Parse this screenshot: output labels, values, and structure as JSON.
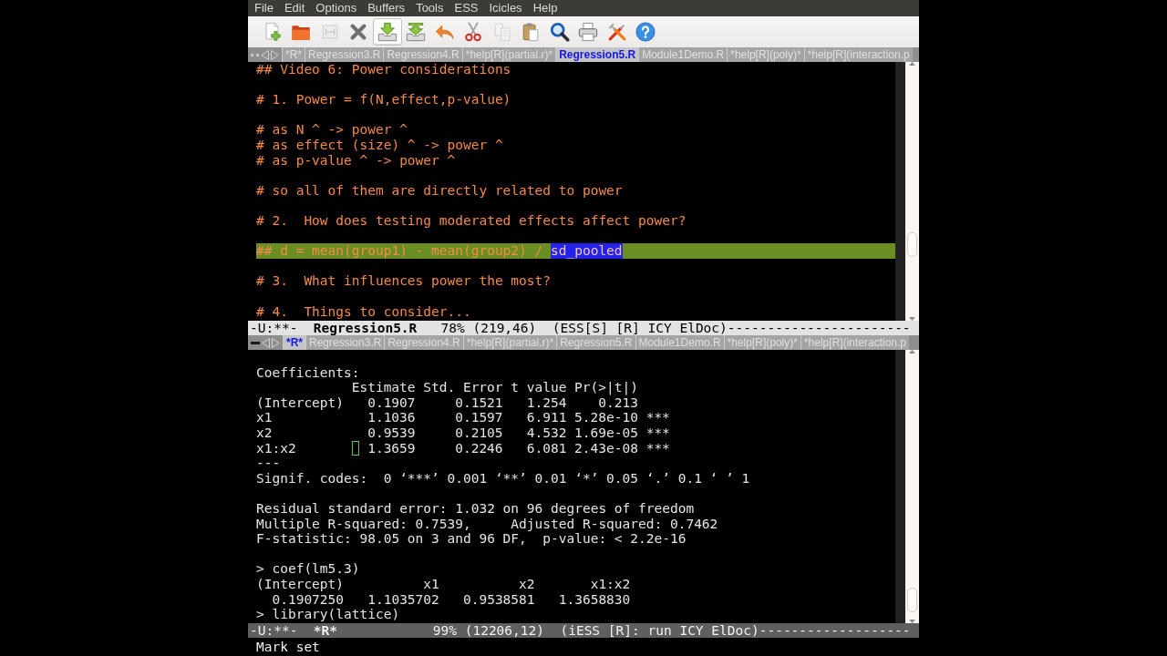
{
  "menu_bar": [
    "File",
    "Edit",
    "Options",
    "Buffers",
    "Tools",
    "ESS",
    "Icicles",
    "Help"
  ],
  "toolbar": [
    {
      "kind": "new",
      "disabled": false,
      "hovered": false
    },
    {
      "kind": "open",
      "disabled": false,
      "hovered": false
    },
    {
      "kind": "frame",
      "disabled": true,
      "hovered": false
    },
    {
      "kind": "close",
      "disabled": false,
      "hovered": false
    },
    {
      "kind": "save",
      "disabled": false,
      "hovered": true
    },
    {
      "kind": "saveas",
      "disabled": false,
      "hovered": false
    },
    {
      "kind": "undo",
      "disabled": false,
      "hovered": false
    },
    {
      "kind": "cut",
      "disabled": false,
      "hovered": false
    },
    {
      "kind": "copy",
      "disabled": true,
      "hovered": false
    },
    {
      "kind": "paste",
      "disabled": false,
      "hovered": false
    },
    {
      "kind": "search",
      "disabled": false,
      "hovered": false
    },
    {
      "kind": "print",
      "disabled": false,
      "hovered": false
    },
    {
      "kind": "preferences",
      "disabled": false,
      "hovered": false
    },
    {
      "kind": "help",
      "disabled": false,
      "hovered": false
    }
  ],
  "windows": [
    {
      "kind": "editor",
      "active": true,
      "tabs": [
        {
          "label": "*R*",
          "selected": false
        },
        {
          "label": "Regression3.R",
          "selected": false
        },
        {
          "label": "Regression4.R",
          "selected": false
        },
        {
          "label": "*help[R](partial.r)*",
          "selected": false
        },
        {
          "label": "Regression5.R",
          "selected": true
        },
        {
          "label": "Module1Demo.R",
          "selected": false
        },
        {
          "label": "*help[R](poly)*",
          "selected": false
        },
        {
          "label": "*help[R](interaction.p",
          "selected": false
        }
      ],
      "lines": [
        {
          "kind": "text",
          "text": "## Video 6: Power considerations"
        },
        {
          "kind": "blank"
        },
        {
          "kind": "text",
          "text": "# 1. Power = f(N,effect,p-value)"
        },
        {
          "kind": "blank"
        },
        {
          "kind": "text",
          "text": "# as N ^ -> power ^"
        },
        {
          "kind": "text",
          "text": "# as effect (size) ^ -> power ^"
        },
        {
          "kind": "text",
          "text": "# as p-value ^ -> power ^"
        },
        {
          "kind": "blank"
        },
        {
          "kind": "text",
          "text": "# so all of them are directly related to power"
        },
        {
          "kind": "blank"
        },
        {
          "kind": "text",
          "text": "# 2.  How does testing moderated effects affect power?"
        },
        {
          "kind": "blank"
        },
        {
          "kind": "current",
          "text": "## d = mean(group1) - mean(group2) /",
          "selection": "sd_pooled"
        },
        {
          "kind": "blank"
        },
        {
          "kind": "text",
          "text": "# 3.  What influences power the most?"
        },
        {
          "kind": "blank"
        },
        {
          "kind": "text",
          "text": "# 4.  Things to consider..."
        }
      ],
      "mode_line": {
        "status": "-U:**-",
        "buffer": "Regression5.R",
        "position": "78% (219,46)",
        "modes": "(ESS[S] [R] ICY ElDoc)",
        "dashes": "-----------------------"
      }
    },
    {
      "kind": "console",
      "active": false,
      "tabs": [
        {
          "label": "*R*",
          "selected": true
        },
        {
          "label": "Regression3.R",
          "selected": false
        },
        {
          "label": "Regression4.R",
          "selected": false
        },
        {
          "label": "*help[R](partial.r)*",
          "selected": false
        },
        {
          "label": "Regression5.R",
          "selected": false
        },
        {
          "label": "Module1Demo.R",
          "selected": false
        },
        {
          "label": "*help[R](poly)*",
          "selected": false
        },
        {
          "label": "*help[R](interaction.p",
          "selected": false
        }
      ],
      "lines": [
        {
          "kind": "blank"
        },
        {
          "kind": "text",
          "text": "Coefficients:"
        },
        {
          "kind": "table",
          "columns": [
            "Estimate",
            "Std. Error",
            "t value",
            "Pr(>|t|)"
          ],
          "rows": [
            {
              "name": "(Intercept)",
              "cells": [
                "0.1907",
                "0.1521",
                "1.254",
                "0.213"
              ],
              "cursor": false
            },
            {
              "name": "x1",
              "cells": [
                "1.1036",
                "0.1597",
                "6.911",
                "5.28e-10"
              ],
              "signif": "***",
              "cursor": false
            },
            {
              "name": "x2",
              "cells": [
                "0.9539",
                "0.2105",
                "4.532",
                "1.69e-05"
              ],
              "signif": "***",
              "cursor": false
            },
            {
              "name": "x1:x2",
              "cells": [
                "1.3659",
                "0.2246",
                "6.081",
                "2.43e-08"
              ],
              "signif": "***",
              "cursor": true
            }
          ]
        },
        {
          "kind": "text",
          "text": "---"
        },
        {
          "kind": "text",
          "text": "Signif. codes:  0 ‘***’ 0.001 ‘**’ 0.01 ‘*’ 0.05 ‘.’ 0.1 ‘ ’ 1"
        },
        {
          "kind": "blank"
        },
        {
          "kind": "text",
          "text": "Residual standard error: 1.032 on 96 degrees of freedom"
        },
        {
          "kind": "text",
          "text": "Multiple R-squared: 0.7539,     Adjusted R-squared: 0.7462"
        },
        {
          "kind": "text",
          "text": "F-statistic: 98.05 on 3 and 96 DF,  p-value: < 2.2e-16"
        },
        {
          "kind": "blank"
        },
        {
          "kind": "text",
          "text": "> coef(lm5.3)"
        },
        {
          "kind": "text",
          "text": "(Intercept)          x1          x2       x1:x2"
        },
        {
          "kind": "text",
          "text": "  0.1907250   1.1035702   0.9538581   1.3658830"
        },
        {
          "kind": "text",
          "text": "> library(lattice)"
        }
      ],
      "mode_line": {
        "status": "-U:**-",
        "buffer": "*R*",
        "position": "99% (12206,12)",
        "modes": "(iESS [R]: run ICY ElDoc)",
        "dashes": "-------------------"
      }
    }
  ],
  "echo_area": "Mark set"
}
